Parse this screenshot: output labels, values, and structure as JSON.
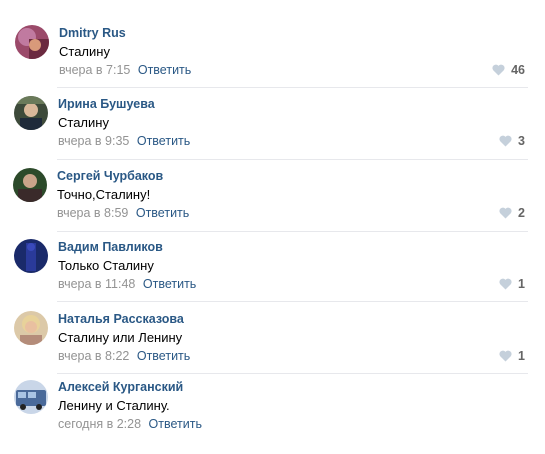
{
  "comments": [
    {
      "author": "Dmitry Rus",
      "text": "Сталину",
      "time": "вчера в 7:15",
      "reply": "Ответить",
      "likes": "46"
    },
    {
      "author": "Ирина Бушуева",
      "text": "Сталину",
      "time": "вчера в 9:35",
      "reply": "Ответить",
      "likes": "3"
    },
    {
      "author": "Сергей Чурбаков",
      "text": "Точно,Сталину!",
      "time": "вчера в 8:59",
      "reply": "Ответить",
      "likes": "2"
    },
    {
      "author": "Вадим Павликов",
      "text": "Только Сталину",
      "time": "вчера в 11:48",
      "reply": "Ответить",
      "likes": "1"
    },
    {
      "author": "Наталья Рассказова",
      "text": "Сталину или Ленину",
      "time": "вчера в 8:22",
      "reply": "Ответить",
      "likes": "1"
    },
    {
      "author": "Алексей Курганский",
      "text": "Ленину и Сталину.",
      "time": "сегодня в 2:28",
      "reply": "Ответить",
      "likes": null
    }
  ],
  "colors": {
    "author_link": "#2a5885",
    "meta": "#939393",
    "like_icon": "#c5d0db",
    "divider": "#e7e8ec"
  },
  "icons": {
    "like": "heart-icon"
  }
}
